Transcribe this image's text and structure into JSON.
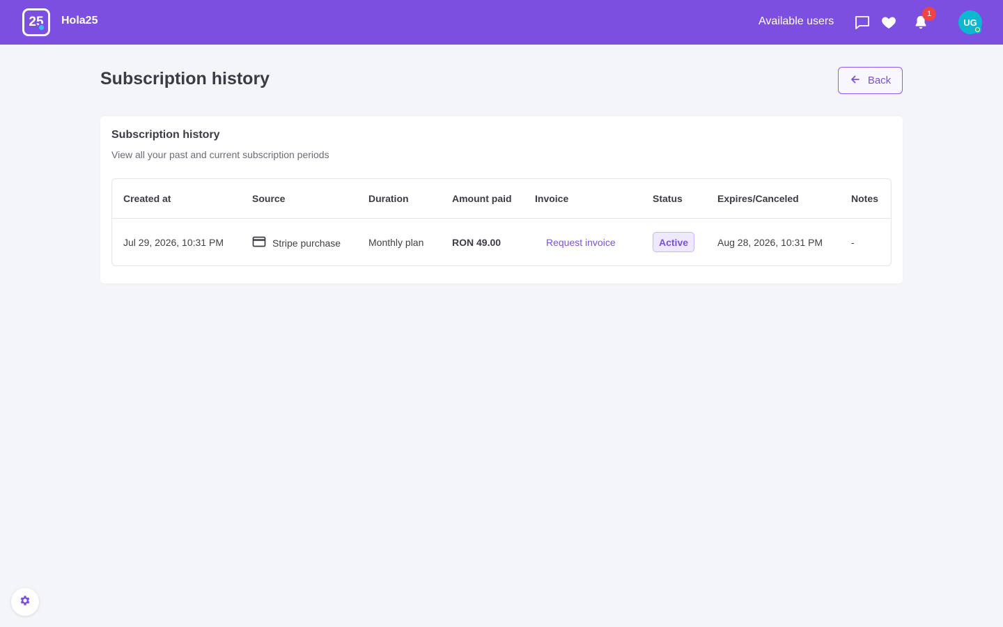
{
  "header": {
    "logo_text": "25",
    "brand": "Hola25",
    "nav_link": "Available users",
    "notification_count": "1",
    "avatar_initials": "UG"
  },
  "page": {
    "title": "Subscription history",
    "back_label": "Back"
  },
  "card": {
    "title": "Subscription history",
    "subtitle": "View all your past and current subscription periods"
  },
  "table": {
    "columns": [
      "Created at",
      "Source",
      "Duration",
      "Amount paid",
      "Invoice",
      "Status",
      "Expires/Canceled",
      "Notes"
    ],
    "rows": [
      {
        "created_at": "Jul 29, 2026, 10:31 PM",
        "source": "Stripe purchase",
        "source_icon": "credit-card-icon",
        "duration": "Monthly plan",
        "amount": "RON 49.00",
        "invoice": "Request invoice",
        "status": "Active",
        "expires": "Aug 28, 2026, 10:31 PM",
        "notes": "-"
      }
    ]
  },
  "colors": {
    "primary": "#7c4fe0",
    "background": "#f4f5f9",
    "badge_notification": "#ef4444",
    "avatar": "#0bb8cf"
  },
  "icons": {
    "chat": "chat-icon",
    "favorites": "heart-icon",
    "notifications": "bell-icon",
    "back": "arrow-left-icon",
    "settings": "gear-icon"
  }
}
